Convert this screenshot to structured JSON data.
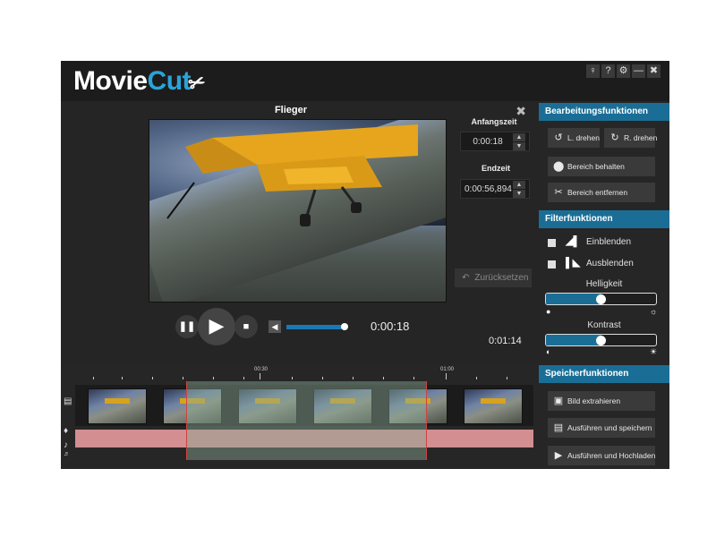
{
  "app": {
    "logo_part1": "Movie",
    "logo_part2": "Cut",
    "window_buttons": {
      "hint": "♀",
      "help": "?",
      "settings": "⚙",
      "minimize": "—",
      "close": "✖"
    }
  },
  "player": {
    "title": "Flieger",
    "start_label": "Anfangszeit",
    "start_value": "0:00:18",
    "end_label": "Endzeit",
    "end_value": "0:00:56,894",
    "reset_label": "Zurücksetzen",
    "current_time": "0:00:18",
    "total_time": "0:01:14",
    "volume_level": 0.85
  },
  "timeline": {
    "tick_labels": [
      "00:30",
      "01:00"
    ]
  },
  "panel": {
    "edit_header": "Bearbeitungsfunktionen",
    "rotate_left": "L. drehen",
    "rotate_right": "R. drehen",
    "keep_range": "Bereich behalten",
    "remove_range": "Bereich entfernen",
    "filter_header": "Filterfunktionen",
    "fade_in": "Einblenden",
    "fade_out": "Ausblenden",
    "brightness": "Helligkeit",
    "brightness_value": 0.5,
    "contrast": "Kontrast",
    "contrast_value": 0.5,
    "save_header": "Speicherfunktionen",
    "extract_image": "Bild extrahieren",
    "export_save": "Ausführen und speichern",
    "export_upload": "Ausführen und Hochladen"
  }
}
